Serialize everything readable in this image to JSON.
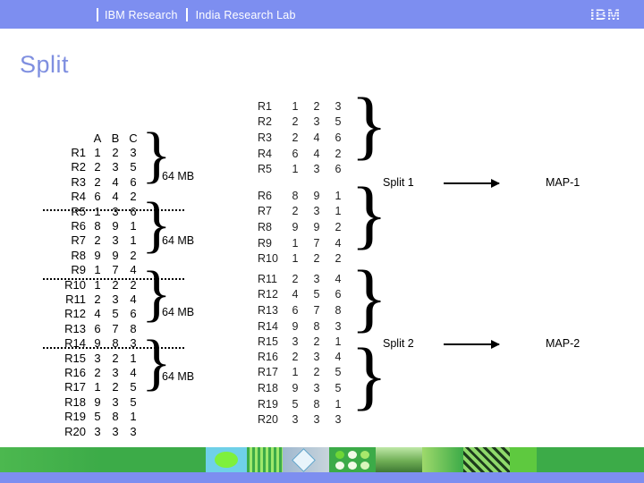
{
  "header": {
    "title": "IBM Research",
    "subtitle": "India Research Lab",
    "logo": "IBM"
  },
  "page": {
    "title": "Split"
  },
  "left_table": {
    "columns": [
      "A",
      "B",
      "C"
    ],
    "rows": [
      {
        "label": "R1",
        "values": [
          1,
          2,
          3
        ]
      },
      {
        "label": "R2",
        "values": [
          2,
          3,
          5
        ]
      },
      {
        "label": "R3",
        "values": [
          2,
          4,
          6
        ]
      },
      {
        "label": "R4",
        "values": [
          6,
          4,
          2
        ]
      },
      {
        "label": "R5",
        "values": [
          1,
          3,
          6
        ]
      },
      {
        "label": "R6",
        "values": [
          8,
          9,
          1
        ]
      },
      {
        "label": "R7",
        "values": [
          2,
          3,
          1
        ]
      },
      {
        "label": "R8",
        "values": [
          9,
          9,
          2
        ]
      },
      {
        "label": "R9",
        "values": [
          1,
          7,
          4
        ]
      },
      {
        "label": "R10",
        "values": [
          1,
          2,
          2
        ]
      },
      {
        "label": "R11",
        "values": [
          2,
          3,
          4
        ]
      },
      {
        "label": "R12",
        "values": [
          4,
          5,
          6
        ]
      },
      {
        "label": "R13",
        "values": [
          6,
          7,
          8
        ]
      },
      {
        "label": "R14",
        "values": [
          9,
          8,
          3
        ]
      },
      {
        "label": "R15",
        "values": [
          3,
          2,
          1
        ]
      },
      {
        "label": "R16",
        "values": [
          2,
          3,
          4
        ]
      },
      {
        "label": "R17",
        "values": [
          1,
          2,
          5
        ]
      },
      {
        "label": "R18",
        "values": [
          9,
          3,
          5
        ]
      },
      {
        "label": "R19",
        "values": [
          5,
          8,
          1
        ]
      },
      {
        "label": "R20",
        "values": [
          3,
          3,
          3
        ]
      }
    ]
  },
  "chunk_labels": [
    "64 MB",
    "64 MB",
    "64 MB",
    "64 MB"
  ],
  "blocks": [
    {
      "rows": [
        {
          "label": "R1",
          "values": [
            1,
            2,
            3
          ]
        },
        {
          "label": "R2",
          "values": [
            2,
            3,
            5
          ]
        },
        {
          "label": "R3",
          "values": [
            2,
            4,
            6
          ]
        },
        {
          "label": "R4",
          "values": [
            6,
            4,
            2
          ]
        },
        {
          "label": "R5",
          "values": [
            1,
            3,
            6
          ]
        }
      ]
    },
    {
      "rows": [
        {
          "label": "R6",
          "values": [
            8,
            9,
            1
          ]
        },
        {
          "label": "R7",
          "values": [
            2,
            3,
            1
          ]
        },
        {
          "label": "R8",
          "values": [
            9,
            9,
            2
          ]
        },
        {
          "label": "R9",
          "values": [
            1,
            7,
            4
          ]
        },
        {
          "label": "R10",
          "values": [
            1,
            2,
            2
          ]
        }
      ]
    },
    {
      "rows": [
        {
          "label": "R11",
          "values": [
            2,
            3,
            4
          ]
        },
        {
          "label": "R12",
          "values": [
            4,
            5,
            6
          ]
        },
        {
          "label": "R13",
          "values": [
            6,
            7,
            8
          ]
        },
        {
          "label": "R14",
          "values": [
            9,
            8,
            3
          ]
        },
        {
          "label": "R15",
          "values": [
            3,
            2,
            1
          ]
        }
      ]
    },
    {
      "rows": [
        {
          "label": "R16",
          "values": [
            2,
            3,
            4
          ]
        },
        {
          "label": "R17",
          "values": [
            1,
            2,
            5
          ]
        },
        {
          "label": "R18",
          "values": [
            9,
            3,
            5
          ]
        },
        {
          "label": "R19",
          "values": [
            5,
            8,
            1
          ]
        },
        {
          "label": "R20",
          "values": [
            3,
            3,
            3
          ]
        }
      ]
    }
  ],
  "splits": [
    {
      "label": "Split 1",
      "map": "MAP-1"
    },
    {
      "label": "Split 2",
      "map": "MAP-2"
    }
  ],
  "colors": {
    "header_band": "#7d8ef0",
    "title": "#7f8fe0",
    "footer_green": "#3cab48",
    "footer_blue": "#7d8ef0"
  }
}
